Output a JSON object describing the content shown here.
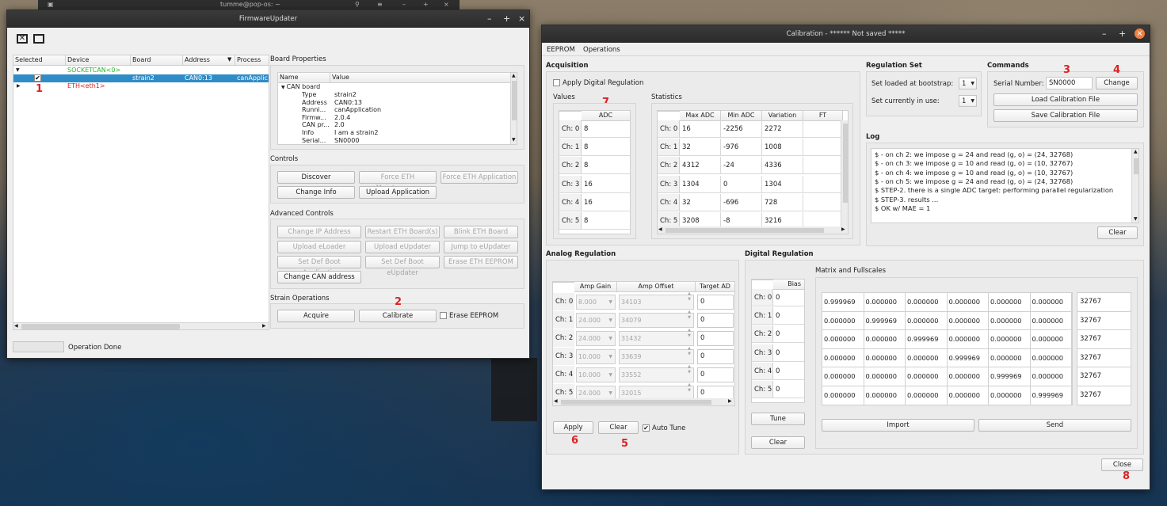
{
  "taskbar": {
    "title": "tumme@pop-os: ~"
  },
  "fw": {
    "title": "FirmwareUpdater",
    "tree": {
      "headers": [
        "Selected",
        "Device",
        "Board",
        "Address",
        "Process"
      ],
      "socketcan": "SOCKETCAN<0>",
      "board": "strain2",
      "address": "CAN0:13",
      "process": "canApplic",
      "eth": "ETH<eth1>"
    },
    "board_props": {
      "title": "Board Properties",
      "headers": [
        "Name",
        "Value"
      ],
      "root": "CAN board",
      "rows": [
        [
          "Type",
          "strain2"
        ],
        [
          "Address",
          "CAN0:13"
        ],
        [
          "Runni...",
          "canApplication"
        ],
        [
          "Firmw...",
          "2.0.4"
        ],
        [
          "CAN pr...",
          "2.0"
        ],
        [
          "Info",
          "I am a strain2"
        ],
        [
          "Serial...",
          "SN0000"
        ]
      ]
    },
    "controls": {
      "title": "Controls",
      "discover": "Discover",
      "force_maint": "Force ETH Maintenance",
      "force_app": "Force ETH Application",
      "change_info": "Change Info",
      "upload_app": "Upload Application"
    },
    "advanced": {
      "title": "Advanced Controls",
      "b": [
        "Change IP Address",
        "Restart ETH Board(s)",
        "Blink ETH Board",
        "Upload eLoader",
        "Upload eUpdater",
        "Jump to eUpdater",
        "Set Def Boot eApplication",
        "Set Def Boot eUpdater",
        "Erase ETH EEPROM"
      ],
      "change_can": "Change CAN address"
    },
    "strain": {
      "title": "Strain Operations",
      "acquire": "Acquire",
      "calibrate": "Calibrate",
      "erase": "Erase EEPROM"
    },
    "status": "Operation Done"
  },
  "cal": {
    "title": "Calibration - ****** Not saved *****",
    "menu": [
      "EEPROM",
      "Operations"
    ],
    "acq": {
      "title": "Acquisition",
      "apply_digital": "Apply Digital Regulation",
      "values": "Values",
      "statistics": "Statistics",
      "adc_header": "ADC",
      "ch": [
        "Ch: 0",
        "Ch: 1",
        "Ch: 2",
        "Ch: 3",
        "Ch: 4",
        "Ch: 5"
      ],
      "adc": [
        "8",
        "8",
        "8",
        "16",
        "16",
        "8"
      ],
      "stat_headers": [
        "Max ADC",
        "Min ADC",
        "Variation",
        "FT"
      ],
      "stats": [
        [
          "16",
          "-2256",
          "2272",
          ""
        ],
        [
          "32",
          "-976",
          "1008",
          ""
        ],
        [
          "4312",
          "-24",
          "4336",
          ""
        ],
        [
          "1304",
          "0",
          "1304",
          ""
        ],
        [
          "32",
          "-696",
          "728",
          ""
        ],
        [
          "3208",
          "-8",
          "3216",
          ""
        ]
      ]
    },
    "reg": {
      "title": "Regulation Set",
      "loaded": "Set loaded at bootstrap:",
      "loaded_val": "1",
      "current": "Set currently in use:",
      "current_val": "1"
    },
    "cmd": {
      "title": "Commands",
      "serial_label": "Serial Number:",
      "serial": "SN0000",
      "change": "Change",
      "load": "Load Calibration File",
      "save": "Save Calibration File"
    },
    "log": {
      "title": "Log",
      "lines": [
        "$ - on ch 2: we impose g = 24 and read (g, o) = (24, 32768)",
        "$ - on ch 3: we impose g = 10 and read (g, o) = (10, 32767)",
        "$ - on ch 4: we impose g = 10 and read (g, o) = (10, 32767)",
        "$ - on ch 5: we impose g = 24 and read (g, o) = (24, 32768)",
        "$ STEP-2. there is a single ADC target: performing parallel regularization",
        "$ STEP-3. results ...",
        "$  OK w/ MAE = 1"
      ],
      "clear": "Clear"
    },
    "analog": {
      "title": "Analog Regulation",
      "headers": [
        "Amp Gain",
        "Amp Offset",
        "Target AD"
      ],
      "gain": [
        "8.000",
        "24.000",
        "24.000",
        "10.000",
        "10.000",
        "24.000"
      ],
      "offset": [
        "34103",
        "34079",
        "31432",
        "33639",
        "33552",
        "32015"
      ],
      "target": [
        "0",
        "0",
        "0",
        "0",
        "0",
        "0"
      ],
      "apply": "Apply",
      "clear": "Clear",
      "auto_tune": "Auto Tune"
    },
    "digital": {
      "title": "Digital Regulation",
      "bias_header": "Bias",
      "bias": [
        "0",
        "0",
        "0",
        "0",
        "0",
        "0"
      ],
      "tune": "Tune",
      "clear": "Clear",
      "matrix_title": "Matrix and Fullscales",
      "matrix": [
        [
          "0.999969",
          "0.000000",
          "0.000000",
          "0.000000",
          "0.000000",
          "0.000000"
        ],
        [
          "0.000000",
          "0.999969",
          "0.000000",
          "0.000000",
          "0.000000",
          "0.000000"
        ],
        [
          "0.000000",
          "0.000000",
          "0.999969",
          "0.000000",
          "0.000000",
          "0.000000"
        ],
        [
          "0.000000",
          "0.000000",
          "0.000000",
          "0.999969",
          "0.000000",
          "0.000000"
        ],
        [
          "0.000000",
          "0.000000",
          "0.000000",
          "0.000000",
          "0.999969",
          "0.000000"
        ],
        [
          "0.000000",
          "0.000000",
          "0.000000",
          "0.000000",
          "0.000000",
          "0.999969"
        ]
      ],
      "fullscales": [
        "32767",
        "32767",
        "32767",
        "32767",
        "32767",
        "32767"
      ],
      "import": "Import",
      "send": "Send"
    },
    "close": "Close"
  },
  "annotations": [
    "1",
    "2",
    "3",
    "4",
    "5",
    "6",
    "7",
    "8"
  ]
}
